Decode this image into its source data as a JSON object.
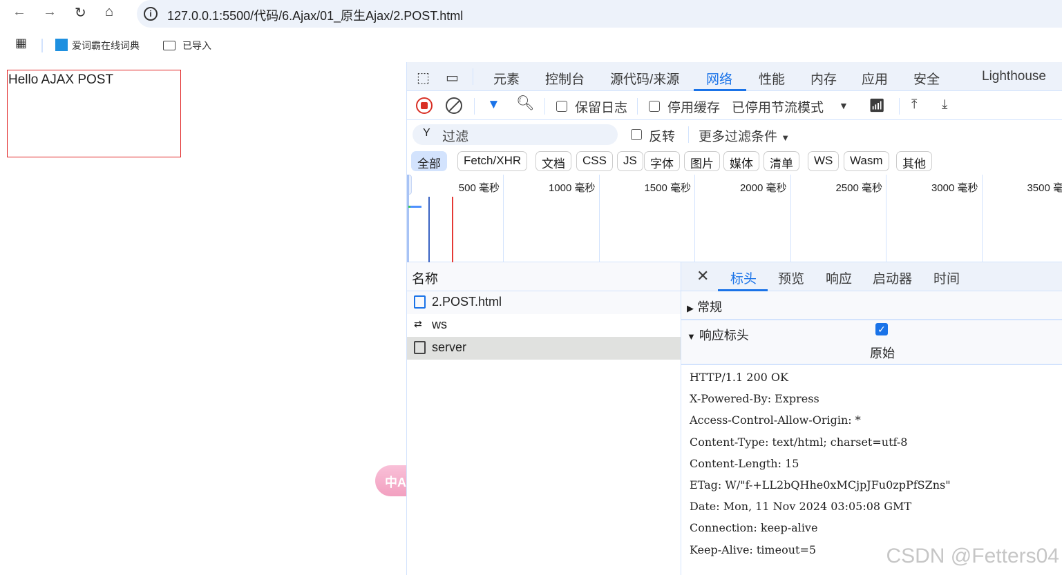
{
  "browser": {
    "url": "127.0.0.1:5500/代码/6.Ajax/01_原生Ajax/2.POST.html",
    "bookmarks": [
      "爱词霸在线词典",
      "已导入"
    ]
  },
  "page": {
    "content": "Hello AJAX POST"
  },
  "devtools": {
    "tabs": [
      "元素",
      "控制台",
      "源代码/来源",
      "网络",
      "性能",
      "内存",
      "应用",
      "安全",
      "Lighthouse"
    ],
    "active_tab": "网络",
    "toolbar": {
      "preserve_log": "保留日志",
      "disable_cache": "停用缓存",
      "throttling": "已停用节流模式",
      "preserve_log_checked": false,
      "disable_cache_checked": false
    },
    "filter": {
      "placeholder": "过滤",
      "invert": "反转",
      "more_filters": "更多过滤条件"
    },
    "types": [
      "全部",
      "Fetch/XHR",
      "文档",
      "CSS",
      "JS",
      "字体",
      "图片",
      "媒体",
      "清单",
      "WS",
      "Wasm",
      "其他"
    ],
    "active_type": "全部",
    "timeline_ticks": [
      "500 毫秒",
      "1000 毫秒",
      "1500 毫秒",
      "2000 毫秒",
      "2500 毫秒",
      "3000 毫秒",
      "3500 毫秒"
    ],
    "list": {
      "header": "名称",
      "rows": [
        {
          "name": "2.POST.html",
          "icon": "document-icon"
        },
        {
          "name": "ws",
          "icon": "websocket-icon"
        },
        {
          "name": "server",
          "icon": "file-icon",
          "selected": true
        }
      ]
    },
    "detail": {
      "tabs": [
        "标头",
        "预览",
        "响应",
        "启动器",
        "时间"
      ],
      "active": "标头",
      "general": "常规",
      "response_headers": "响应标头",
      "raw_label": "原始",
      "raw_checked": true,
      "raw_lines": [
        "HTTP/1.1 200 OK",
        "X-Powered-By: Express",
        "Access-Control-Allow-Origin: *",
        "Content-Type: text/html; charset=utf-8",
        "Content-Length: 15",
        "ETag: W/\"f-+LL2bQHhe0xMCjpJFu0zpPfSZns\"",
        "Date: Mon, 11 Nov 2024 03:05:08 GMT",
        "Connection: keep-alive",
        "Keep-Alive: timeout=5"
      ]
    }
  },
  "watermark": "CSDN @Fetters04",
  "colors": {
    "accent": "#1a73e8",
    "record": "#d93025"
  }
}
